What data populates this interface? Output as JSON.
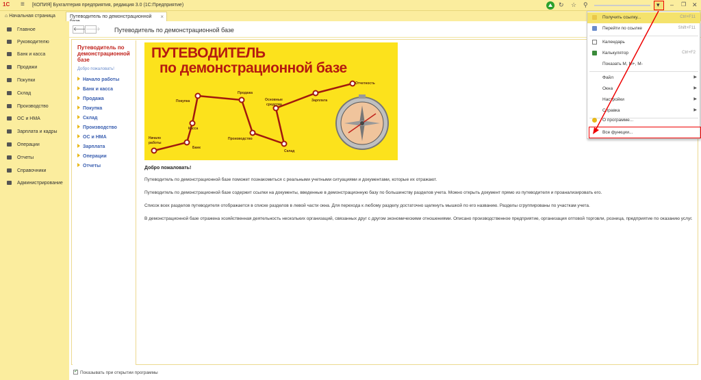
{
  "titlebar": {
    "logo": "1С",
    "title": "[КОПИЯ] Бухгалтерия предприятия, редакция 3.0  (1С:Предприятие)"
  },
  "tabs": [
    {
      "label": "Начальная страница"
    },
    {
      "label": "Путеводитель по демонстрационной базе"
    }
  ],
  "sidebar": {
    "items": [
      {
        "label": "Главное",
        "icon": "menu-icon"
      },
      {
        "label": "Руководителю",
        "icon": "chart-icon"
      },
      {
        "label": "Банк и касса",
        "icon": "bank-icon"
      },
      {
        "label": "Продажи",
        "icon": "cart-icon"
      },
      {
        "label": "Покупки",
        "icon": "bag-icon"
      },
      {
        "label": "Склад",
        "icon": "warehouse-icon"
      },
      {
        "label": "Производство",
        "icon": "factory-icon"
      },
      {
        "label": "ОС и НМА",
        "icon": "assets-icon"
      },
      {
        "label": "Зарплата и кадры",
        "icon": "people-icon"
      },
      {
        "label": "Операции",
        "icon": "operations-icon"
      },
      {
        "label": "Отчеты",
        "icon": "reports-icon"
      },
      {
        "label": "Справочники",
        "icon": "books-icon"
      },
      {
        "label": "Администрирование",
        "icon": "gear-icon"
      }
    ]
  },
  "form": {
    "title": "Путеводитель по демонстрационной базе",
    "back": "🡐",
    "forward": "🡒"
  },
  "guide": {
    "title": "Путеводитель по демонстрационной базе",
    "welcome": "Добро пожаловать!",
    "sections": [
      "Начало работы",
      "Банк и касса",
      "Продажа",
      "Покупка",
      "Склад",
      "Производство",
      "ОС и НМА",
      "Зарплата",
      "Операции",
      "Отчеты"
    ]
  },
  "banner": {
    "line1": "ПУТЕВОДИТЕЛЬ",
    "line2": "по демонстрационной базе",
    "labels": {
      "start1": "Начало",
      "start2": "работы",
      "bank": "Банк",
      "kassa": "Касса",
      "pokupka": "Покупка",
      "prodazha": "Продажа",
      "proizvodstvo": "Производство",
      "os1": "Основные",
      "os2": "средства",
      "sklad": "Склад",
      "zarplata": "Зарплата",
      "otchetnost": "Отчетность"
    }
  },
  "content": {
    "heading": "Добро пожаловать!",
    "p1": "Путеводитель по демонстрационной базе поможет познакомиться с реальными учетными ситуациями и документами, которые их отражают.",
    "p2": "Путеводитель по демонстрационной базе содержит ссылки на документы, введенные в демонстрационную базу по большинству разделов учета. Можно открыть документ прямо из путеводителя и проанализировать его.",
    "p3": "Список всех разделов путеводителя отображается в списке разделов в левой части окна. Для перехода к любому разделу достаточно щелкнуть мышкой по его названию. Разделы сгруппированы по участкам учета.",
    "p4": "В демонстрационной базе отражена хозяйственная деятельность нескольких организаций, связанных друг с другом экономическими отношениями. Описано производственное предприятие, организация оптовой торговли, розница, предприятие по оказанию услуг."
  },
  "footer": {
    "checkbox_label": "Показывать при открытии программы"
  },
  "menu": {
    "items": [
      {
        "label": "Получить ссылку...",
        "shortcut": "Ctrl+F11",
        "icon": "link-icon"
      },
      {
        "label": "Перейти по ссылке",
        "shortcut": "Shift+F11",
        "icon": "goto-link-icon"
      },
      {
        "label": "Календарь",
        "shortcut": "",
        "icon": "calendar-icon"
      },
      {
        "label": "Калькулятор",
        "shortcut": "Ctrl+F2",
        "icon": "calculator-icon"
      },
      {
        "label": "Показать М, М+, М-",
        "shortcut": "",
        "icon": ""
      },
      {
        "label": "Файл",
        "shortcut": "",
        "icon": ""
      },
      {
        "label": "Окна",
        "shortcut": "",
        "icon": ""
      },
      {
        "label": "Настройки",
        "shortcut": "",
        "icon": ""
      },
      {
        "label": "Справка",
        "shortcut": "",
        "icon": ""
      },
      {
        "label": "О программе...",
        "shortcut": "",
        "icon": "info-icon"
      },
      {
        "label": "Все функции...",
        "shortcut": "",
        "icon": ""
      }
    ]
  },
  "colors": {
    "accent": "#fbed9e",
    "highlight": "#f4e26c",
    "link": "#3a5fb0",
    "brand_red": "#c0201a",
    "annotation": "#e00000"
  }
}
